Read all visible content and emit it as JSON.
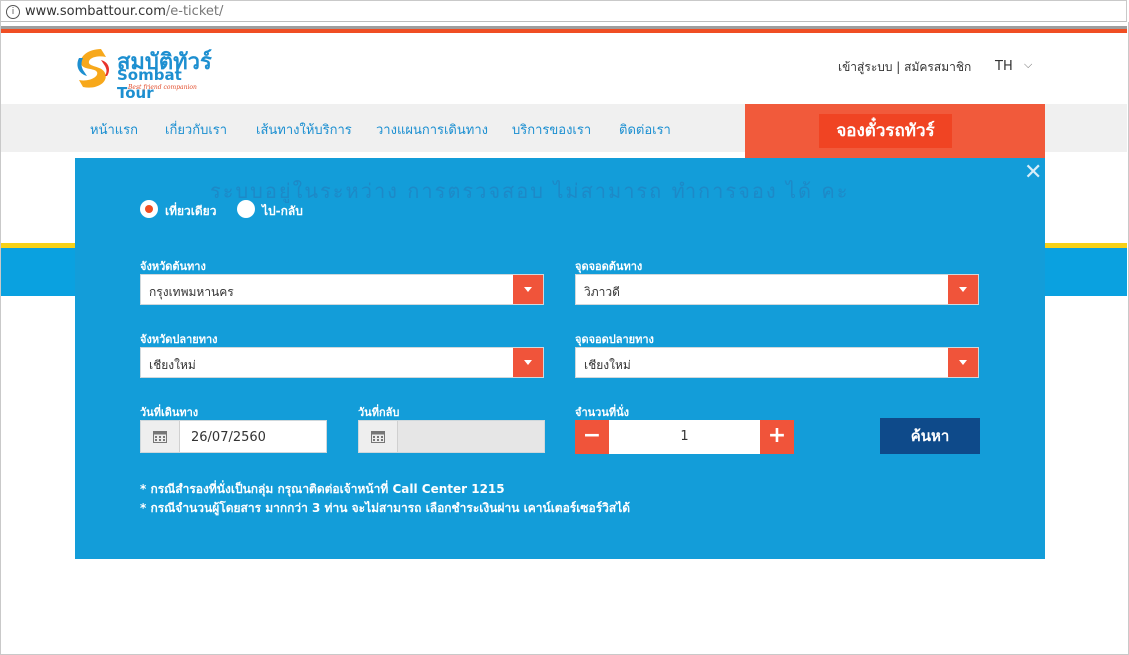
{
  "browser": {
    "info_icon": "info-icon",
    "url_host": "www.sombattour.com",
    "url_path": "/e-ticket/"
  },
  "header": {
    "logo_th": "สมบัติทัวร์",
    "logo_en": "Sombat Tour",
    "logo_tagline": "Best friend companion",
    "auth_text": "เข้าสู่ระบบ | สมัครสมาชิก",
    "lang": "TH"
  },
  "nav": {
    "items": [
      "หน้าแรก",
      "เกี่ยวกับเรา",
      "เส้นทางให้บริการ",
      "วางแผนการเดินทาง",
      "บริการของเรา",
      "ติดต่อเรา"
    ],
    "book_tab": "จองตั๋วรถทัวร์"
  },
  "background_text": "ระบบอยู่ในระหว่าง การตรวจสอบ ไม่สามารถ ทำการจอง ได้ คะ",
  "form": {
    "trip_types": [
      {
        "label": "เที่ยวเดียว",
        "selected": true
      },
      {
        "label": "ไป-กลับ",
        "selected": false
      }
    ],
    "origin_province_label": "จังหวัดต้นทาง",
    "origin_province_value": "กรุงเทพมหานคร",
    "origin_stop_label": "จุดจอดต้นทาง",
    "origin_stop_value": "วิภาวดี",
    "dest_province_label": "จังหวัดปลายทาง",
    "dest_province_value": "เชียงใหม่",
    "dest_stop_label": "จุดจอดปลายทาง",
    "dest_stop_value": "เชียงใหม่",
    "depart_label": "วันที่เดินทาง",
    "depart_value": "26/07/2560",
    "return_label": "วันที่กลับ",
    "return_value": "",
    "seats_label": "จำนวนที่นั่ง",
    "seats_value": "1",
    "minus": "−",
    "plus": "+",
    "search_label": "ค้นหา",
    "notes": [
      "* กรณีสำรองที่นั่งเป็นกลุ่ม กรุณาติดต่อเจ้าหน้าที่ Call Center 1215",
      "* กรณีจำนวนผู้โดยสาร มากกว่า 3 ท่าน จะไม่สามารถ เลือกชำระเงินผ่าน เคาน์เตอร์เซอร์วิสได้"
    ]
  },
  "colors": {
    "accent": "#f04e23",
    "modal": "#139dd9",
    "nav_link": "#1b8fd1",
    "search_btn": "#0e4a8a"
  }
}
